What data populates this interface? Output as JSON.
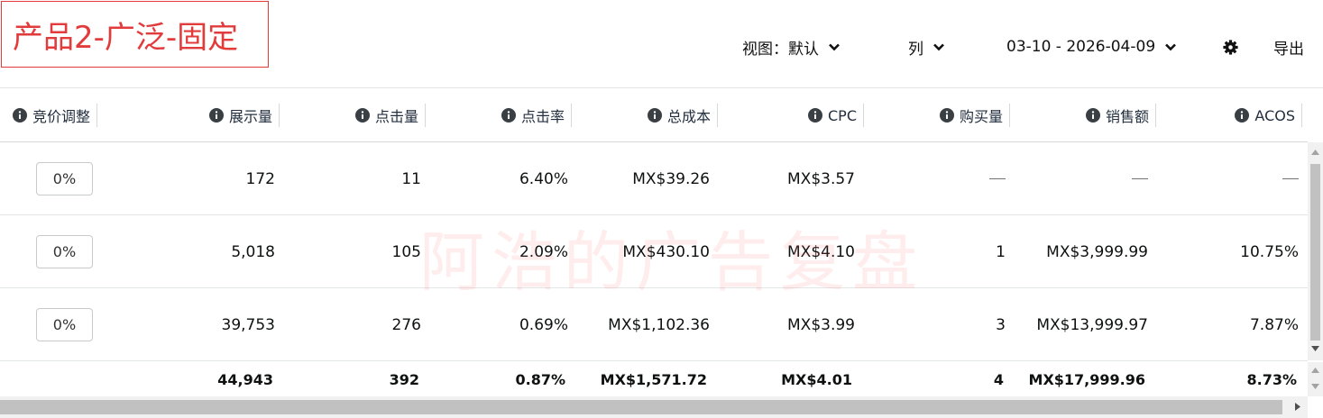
{
  "title": "产品2-广泛-固定",
  "toolbar": {
    "view_label": "视图：默认",
    "columns_label": "列",
    "date_range": "03-10 - 2026-04-09",
    "export_label": "导出",
    "settings_icon": "gear-icon"
  },
  "columns": [
    {
      "label": "竞价调整"
    },
    {
      "label": "展示量"
    },
    {
      "label": "点击量"
    },
    {
      "label": "点击率"
    },
    {
      "label": "总成本"
    },
    {
      "label": "CPC"
    },
    {
      "label": "购买量"
    },
    {
      "label": "销售额"
    },
    {
      "label": "ACOS"
    }
  ],
  "rows": [
    {
      "bid_adjust": "0%",
      "impressions": "172",
      "clicks": "11",
      "ctr": "6.40%",
      "spend": "MX$39.26",
      "cpc": "MX$3.57",
      "orders": "—",
      "sales": "—",
      "acos": "—"
    },
    {
      "bid_adjust": "0%",
      "impressions": "5,018",
      "clicks": "105",
      "ctr": "2.09%",
      "spend": "MX$430.10",
      "cpc": "MX$4.10",
      "orders": "1",
      "sales": "MX$3,999.99",
      "acos": "10.75%"
    },
    {
      "bid_adjust": "0%",
      "impressions": "39,753",
      "clicks": "276",
      "ctr": "0.69%",
      "spend": "MX$1,102.36",
      "cpc": "MX$3.99",
      "orders": "3",
      "sales": "MX$13,999.97",
      "acos": "7.87%"
    }
  ],
  "totals": {
    "impressions": "44,943",
    "clicks": "392",
    "ctr": "0.87%",
    "spend": "MX$1,571.72",
    "cpc": "MX$4.01",
    "orders": "4",
    "sales": "MX$17,999.96",
    "acos": "8.73%"
  },
  "watermark": "阿浩的广告复盘",
  "colors": {
    "title_red": "#e23b3b",
    "border": "#d5d9d9",
    "text": "#0f1111"
  }
}
